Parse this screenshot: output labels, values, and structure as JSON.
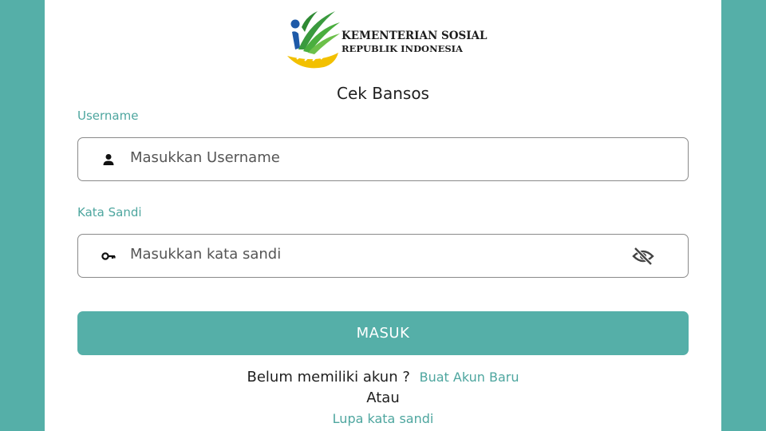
{
  "logo": {
    "line1": "KEMENTERIAN SOSIAL",
    "line2": "REPUBLIK INDONESIA"
  },
  "title": "Cek Bansos",
  "username": {
    "label": "Username",
    "placeholder": "Masukkan Username",
    "icon": "person-icon"
  },
  "password": {
    "label": "Kata Sandi",
    "placeholder": "Masukkan kata sandi",
    "icon": "key-icon",
    "toggle_icon": "eye-off-icon"
  },
  "login_button": "MASUK",
  "register_prompt": "Belum memiliki akun ?",
  "register_link": "Buat Akun Baru",
  "or_text": "Atau",
  "forgot_link": "Lupa kata sandi",
  "colors": {
    "accent": "#55afa8",
    "accent_text": "#4ea69f",
    "logo_green": "#3a9a3e",
    "logo_yellow": "#f2c000",
    "logo_blue": "#1e5aa8"
  }
}
